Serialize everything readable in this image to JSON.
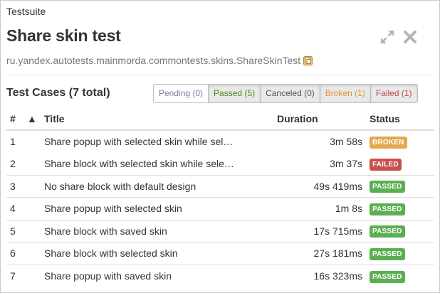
{
  "suite": {
    "label": "Testsuite",
    "title": "Share skin test",
    "path": "ru.yandex.autotests.mainmorda.commontests.skins.ShareSkinTest"
  },
  "cases": {
    "title": "Test Cases (7 total)",
    "filters": {
      "pending": "Pending (0)",
      "passed": "Passed (5)",
      "canceled": "Canceled (0)",
      "broken": "Broken (1)",
      "failed": "Failed (1)"
    },
    "columns": {
      "num": "#",
      "sort": "▲",
      "title": "Title",
      "duration": "Duration",
      "status": "Status"
    },
    "rows": [
      {
        "num": "1",
        "title": "Share popup with selected skin while sel…",
        "duration": "3m 58s",
        "status": "BROKEN"
      },
      {
        "num": "2",
        "title": "Share block with selected skin while sele…",
        "duration": "3m 37s",
        "status": "FAILED"
      },
      {
        "num": "3",
        "title": "No share block with default design",
        "duration": "49s 419ms",
        "status": "PASSED"
      },
      {
        "num": "4",
        "title": "Share popup with selected skin",
        "duration": "1m 8s",
        "status": "PASSED"
      },
      {
        "num": "5",
        "title": "Share block with saved skin",
        "duration": "17s 715ms",
        "status": "PASSED"
      },
      {
        "num": "6",
        "title": "Share block with selected skin",
        "duration": "27s 181ms",
        "status": "PASSED"
      },
      {
        "num": "7",
        "title": "Share popup with saved skin",
        "duration": "16s 323ms",
        "status": "PASSED"
      }
    ]
  },
  "colors": {
    "broken": "#e6a84f",
    "failed": "#c8504c",
    "passed": "#5cae52"
  },
  "icons": {
    "expand": "expand-icon",
    "close": "close-icon",
    "copy": "copy-icon"
  }
}
